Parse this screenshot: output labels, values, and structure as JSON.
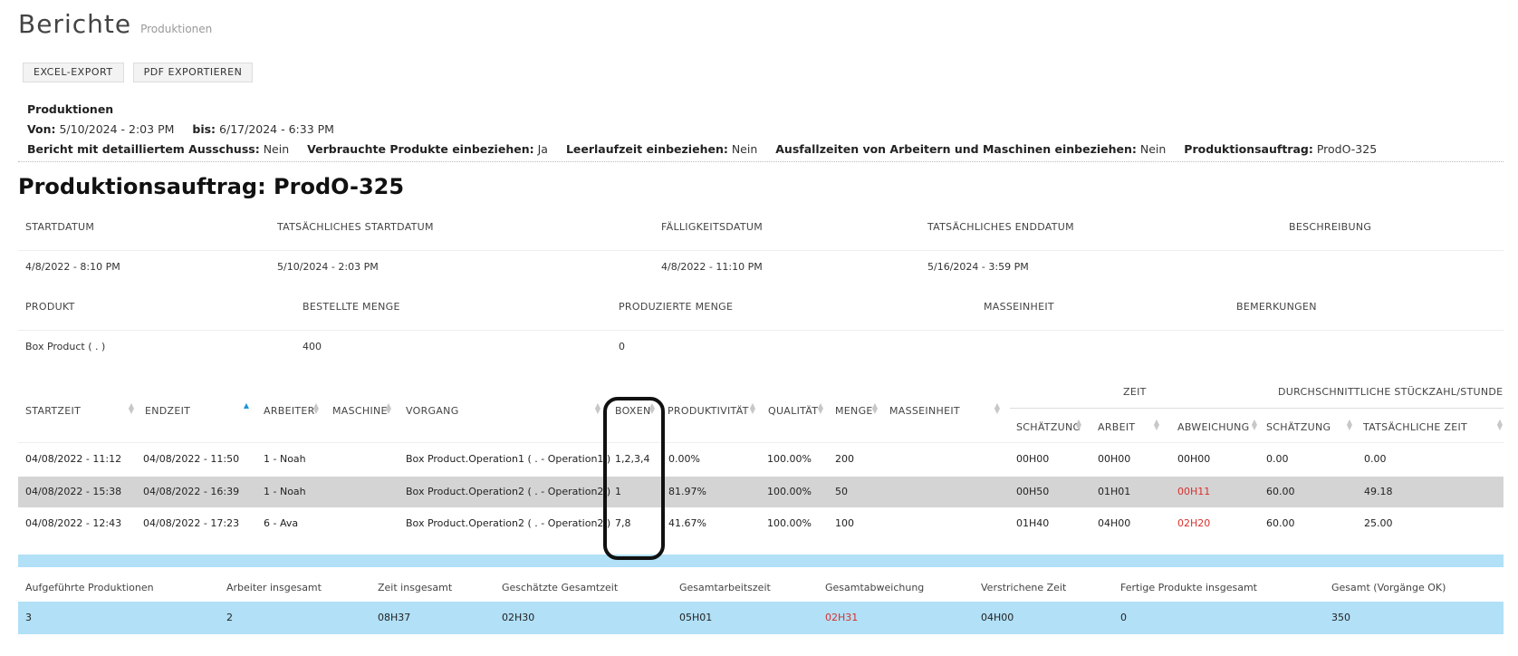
{
  "header": {
    "title": "Berichte",
    "subtitle": "Produktionen"
  },
  "toolbar": {
    "excel_label": "EXCEL-EXPORT",
    "pdf_label": "PDF EXPORTIEREN"
  },
  "filters": {
    "heading": "Produktionen",
    "from_label": "Von:",
    "from_value": "5/10/2024 - 2:03 PM",
    "to_label": "bis:",
    "to_value": "6/17/2024 - 6:33 PM",
    "scrap_label": "Bericht mit detailliertem Ausschuss:",
    "scrap_value": "Nein",
    "consumed_label": "Verbrauchte Produkte einbeziehen:",
    "consumed_value": "Ja",
    "idle_label": "Leerlaufzeit einbeziehen:",
    "idle_value": "Nein",
    "downtime_label": "Ausfallzeiten von Arbeitern und Maschinen einbeziehen:",
    "downtime_value": "Nein",
    "order_label": "Produktionsauftrag:",
    "order_value": "ProdO-325"
  },
  "order": {
    "title": "Produktionsauftrag: ProdO-325",
    "dates_headers": [
      "STARTDATUM",
      "TATSÄCHLICHES STARTDATUM",
      "FÄLLIGKEITSDATUM",
      "TATSÄCHLICHES ENDDATUM",
      "BESCHREIBUNG"
    ],
    "dates_values": [
      "4/8/2022 - 8:10 PM",
      "5/10/2024 - 2:03 PM",
      "4/8/2022 - 11:10 PM",
      "5/16/2024 - 3:59 PM",
      ""
    ],
    "product_headers": [
      "PRODUKT",
      "BESTELLTE MENGE",
      "PRODUZIERTE MENGE",
      "MASSEINHEIT",
      "BEMERKUNGEN"
    ],
    "product_values": [
      "Box Product ( . )",
      "400",
      "0",
      "",
      ""
    ]
  },
  "table": {
    "group_headers": {
      "zeit": "ZEIT",
      "avg": "DURCHSCHNITTLICHE STÜCKZAHL/STUNDE"
    },
    "columns": [
      "STARTZEIT",
      "ENDZEIT",
      "ARBEITER",
      "MASCHINE",
      "VORGANG",
      "BOXEN",
      "PRODUKTIVITÄT",
      "QUALITÄT",
      "MENGE",
      "MASSEINHEIT",
      "SCHÄTZUNG",
      "ARBEIT",
      "ABWEICHUNG",
      "SCHÄTZUNG",
      "TATSÄCHLICHE ZEIT"
    ],
    "rows": [
      [
        "04/08/2022 - 11:12",
        "04/08/2022 - 11:50",
        "1 - Noah",
        "",
        "Box Product.Operation1 ( . - Operation1 )",
        "1,2,3,4",
        "0.00%",
        "100.00%",
        "200",
        "",
        "00H00",
        "00H00",
        "00H00",
        "0.00",
        "0.00"
      ],
      [
        "04/08/2022 - 15:38",
        "04/08/2022 - 16:39",
        "1 - Noah",
        "",
        "Box Product.Operation2 ( . - Operation2 )",
        "1",
        "81.97%",
        "100.00%",
        "50",
        "",
        "00H50",
        "01H01",
        "00H11",
        "60.00",
        "49.18"
      ],
      [
        "04/08/2022 - 12:43",
        "04/08/2022 - 17:23",
        "6 - Ava",
        "",
        "Box Product.Operation2 ( . - Operation2 )",
        "7,8",
        "41.67%",
        "100.00%",
        "100",
        "",
        "01H40",
        "04H00",
        "02H20",
        "60.00",
        "25.00"
      ]
    ],
    "deviation_color": "#d9302c",
    "selected_row_color": "#d4d4d4"
  },
  "summary": {
    "headers": [
      "Aufgeführte Produktionen",
      "Arbeiter insgesamt",
      "Zeit insgesamt",
      "Geschätzte Gesamtzeit",
      "Gesamtarbeitszeit",
      "Gesamtabweichung",
      "Verstrichene Zeit",
      "Fertige Produkte insgesamt",
      "Gesamt (Vorgänge OK)"
    ],
    "values": [
      "3",
      "2",
      "08H37",
      "02H30",
      "05H01",
      "02H31",
      "04H00",
      "0",
      "350"
    ],
    "bar_color": "#b1e0f7"
  }
}
